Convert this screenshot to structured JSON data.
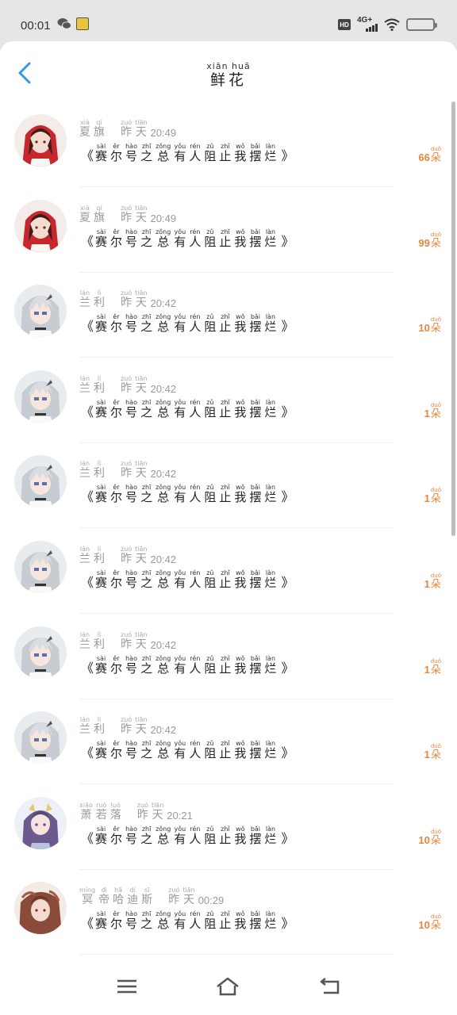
{
  "status_bar": {
    "time": "00:01",
    "network": "4G+",
    "hd": "HD"
  },
  "header": {
    "title_pinyin": "xiān huā",
    "title": "鲜花"
  },
  "item_title": {
    "open": "《",
    "close": "》",
    "chars": [
      {
        "h": "赛",
        "p": "sài"
      },
      {
        "h": "尔",
        "p": "ěr"
      },
      {
        "h": "号",
        "p": "hào"
      },
      {
        "h": "之",
        "p": "zhī"
      },
      {
        "h": "总",
        "p": "zǒng"
      },
      {
        "h": "有",
        "p": "yǒu"
      },
      {
        "h": "人",
        "p": "rén"
      },
      {
        "h": "阻",
        "p": "zǔ"
      },
      {
        "h": "止",
        "p": "zhǐ"
      },
      {
        "h": "我",
        "p": "wǒ"
      },
      {
        "h": "摆",
        "p": "bǎi"
      },
      {
        "h": "烂",
        "p": "làn"
      }
    ]
  },
  "yesterday": [
    {
      "h": "昨",
      "p": "zuó"
    },
    {
      "h": "天",
      "p": "tiān"
    }
  ],
  "unit": {
    "h": "朵",
    "p": "duǒ"
  },
  "items": [
    {
      "name": [
        {
          "h": "夏",
          "p": "xià"
        },
        {
          "h": "旗",
          "p": "qí"
        }
      ],
      "time": "20:49",
      "count": "66",
      "avatar": "red-hood"
    },
    {
      "name": [
        {
          "h": "夏",
          "p": "xià"
        },
        {
          "h": "旗",
          "p": "qí"
        }
      ],
      "time": "20:49",
      "count": "99",
      "avatar": "red-hood"
    },
    {
      "name": [
        {
          "h": "兰",
          "p": "lán"
        },
        {
          "h": "利",
          "p": "lì"
        }
      ],
      "time": "20:42",
      "count": "10",
      "avatar": "silver-hair"
    },
    {
      "name": [
        {
          "h": "兰",
          "p": "lán"
        },
        {
          "h": "利",
          "p": "lì"
        }
      ],
      "time": "20:42",
      "count": "1",
      "avatar": "silver-hair"
    },
    {
      "name": [
        {
          "h": "兰",
          "p": "lán"
        },
        {
          "h": "利",
          "p": "lì"
        }
      ],
      "time": "20:42",
      "count": "1",
      "avatar": "silver-hair"
    },
    {
      "name": [
        {
          "h": "兰",
          "p": "lán"
        },
        {
          "h": "利",
          "p": "lì"
        }
      ],
      "time": "20:42",
      "count": "1",
      "avatar": "silver-hair"
    },
    {
      "name": [
        {
          "h": "兰",
          "p": "lán"
        },
        {
          "h": "利",
          "p": "lì"
        }
      ],
      "time": "20:42",
      "count": "1",
      "avatar": "silver-hair"
    },
    {
      "name": [
        {
          "h": "兰",
          "p": "lán"
        },
        {
          "h": "利",
          "p": "lì"
        }
      ],
      "time": "20:42",
      "count": "1",
      "avatar": "silver-hair"
    },
    {
      "name": [
        {
          "h": "萧",
          "p": "xiāo"
        },
        {
          "h": "若",
          "p": "ruò"
        },
        {
          "h": "落",
          "p": "luò"
        }
      ],
      "time": "20:21",
      "count": "10",
      "avatar": "purple-hair"
    },
    {
      "name": [
        {
          "h": "冥",
          "p": "míng"
        },
        {
          "h": "帝",
          "p": "dì"
        },
        {
          "h": "哈",
          "p": "hā"
        },
        {
          "h": "迪",
          "p": "dí"
        },
        {
          "h": "斯",
          "p": "sī"
        }
      ],
      "time": "00:29",
      "count": "10",
      "avatar": "brown-hair"
    }
  ],
  "colors": {
    "accent_blue": "#2f9be8",
    "count_orange": "#e8873b"
  }
}
